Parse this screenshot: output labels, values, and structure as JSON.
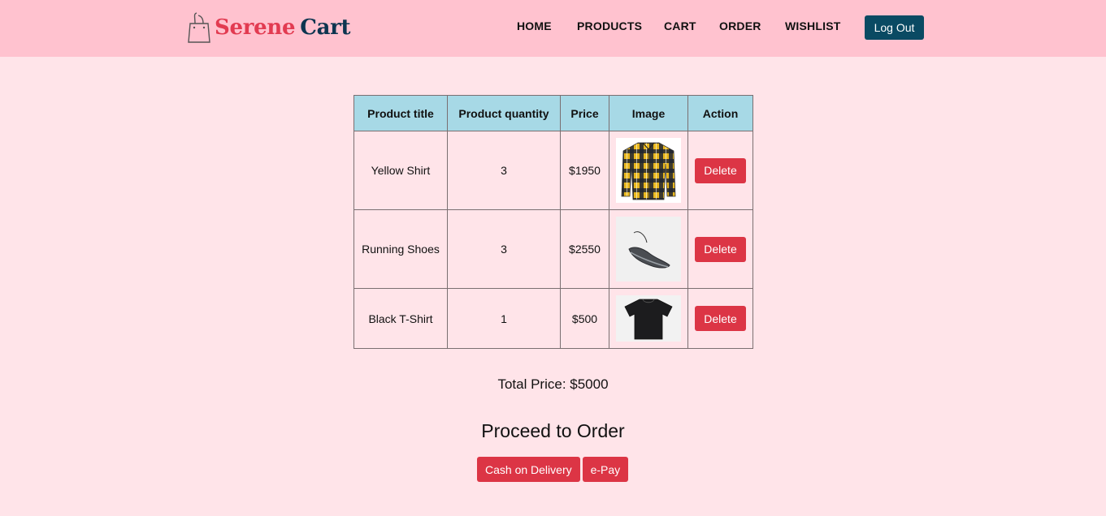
{
  "brand": {
    "name_part1": "Serene",
    "name_part2": "Cart"
  },
  "nav": {
    "home": "HOME",
    "products": "PRODUCTS",
    "cart": "CART",
    "order": "ORDER",
    "wishlist": "WISHLIST",
    "logout": "Log Out"
  },
  "table": {
    "headers": {
      "title": "Product title",
      "quantity": "Product quantity",
      "price": "Price",
      "image": "Image",
      "action": "Action"
    },
    "rows": [
      {
        "title": "Yellow Shirt",
        "quantity": "3",
        "price": "$1950",
        "image": "plaid-shirt-image",
        "action": "Delete"
      },
      {
        "title": "Running Shoes",
        "quantity": "3",
        "price": "$2550",
        "image": "running-shoe-image",
        "action": "Delete"
      },
      {
        "title": "Black T-Shirt",
        "quantity": "1",
        "price": "$500",
        "image": "black-tshirt-image",
        "action": "Delete"
      }
    ]
  },
  "summary": {
    "total": "Total Price: $5000"
  },
  "order": {
    "heading": "Proceed to Order",
    "cod_label": "Cash on Delivery",
    "epay_label": "e-Pay"
  },
  "colors": {
    "header_bg": "#ffc2cf",
    "page_bg": "#ffe4e9",
    "table_header_bg": "#a7d9e6",
    "danger": "#dc3545",
    "logout_bg": "#0a4a63",
    "brand_red": "#e23b51",
    "brand_navy": "#0d3550"
  }
}
